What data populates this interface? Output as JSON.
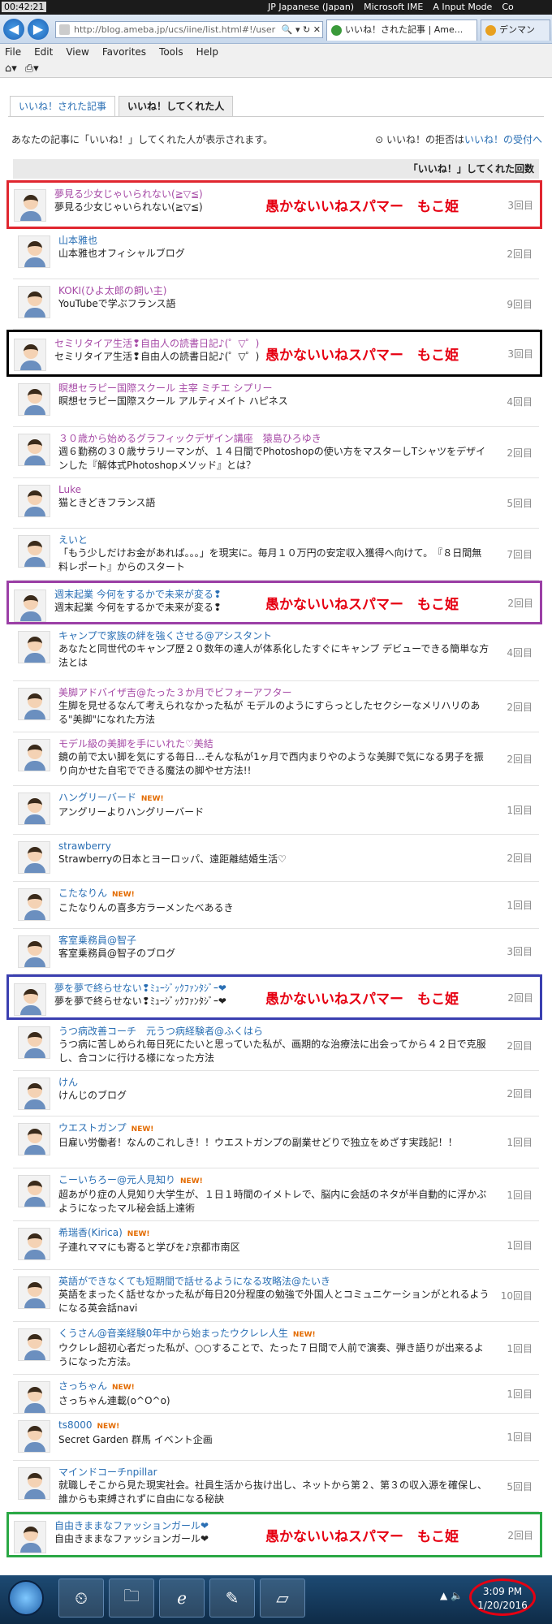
{
  "os": {
    "time_top": "00:42:21",
    "tray": [
      "JP Japanese (Japan)",
      "Microsoft IME",
      "A Input Mode",
      "Co"
    ],
    "clock_time": "3:09 PM",
    "clock_date": "1/20/2016"
  },
  "browser": {
    "url": "http://blog.ameba.jp/ucs/iine/list.html#!/user",
    "tab_active": "いいね！された記事 | Ame...",
    "tab_other": "デンマン"
  },
  "menu": [
    "File",
    "Edit",
    "View",
    "Favorites",
    "Tools",
    "Help"
  ],
  "tabs": [
    "いいね！された記事",
    "いいね！してくれた人"
  ],
  "intro": "あなたの記事に「いいね！」してくれた人が表示されます。",
  "reject": {
    "prefix": "いいね！の拒否は",
    "link": "いいね！の受付へ"
  },
  "header": "「いいね！」してくれた回数",
  "spam_label": "愚かないいねスパマー　もこ姫",
  "rows": [
    {
      "name": "夢見る少女じゃいられない(≧▽≦)",
      "blog": "夢見る少女じゃいられない(≧▽≦)",
      "count": "3回目",
      "visited": true,
      "new": false,
      "spam": true,
      "box": "#e0262f"
    },
    {
      "name": "山本雅也",
      "blog": "山本雅也オフィシャルブログ",
      "count": "2回目",
      "visited": false,
      "new": false,
      "spam": false,
      "box": ""
    },
    {
      "name": "KOKI(ひよ太郎の飼い主)",
      "blog": "YouTubeで学ぶフランス語",
      "count": "9回目",
      "visited": true,
      "new": false,
      "spam": false,
      "box": ""
    },
    {
      "name": "セミリタイア生活❢自由人の読書日記♪(゜▽゜)",
      "blog": "セミリタイア生活❢自由人の読書日記♪(゜▽゜)",
      "count": "3回目",
      "visited": true,
      "new": false,
      "spam": true,
      "box": "#000000"
    },
    {
      "name": "瞑想セラピー国際スクール 主宰 ミチエ シプリー",
      "blog": "瞑想セラピー国際スクール アルティメイト ハピネス",
      "count": "4回目",
      "visited": true,
      "new": false,
      "spam": false,
      "box": ""
    },
    {
      "name": "３０歳から始めるグラフィックデザイン講座　猿島ひろゆき",
      "blog": "週６勤務の３０歳サラリーマンが、１４日間でPhotoshopの使い方をマスターしTシャツをデザインした『解体式Photoshopメソッド』とは？",
      "count": "2回目",
      "visited": true,
      "new": false,
      "spam": false,
      "box": ""
    },
    {
      "name": "Luke",
      "blog": "猫ときどきフランス語",
      "count": "5回目",
      "visited": true,
      "new": false,
      "spam": false,
      "box": ""
    },
    {
      "name": "えいと",
      "blog": "「もう少しだけお金があれば。。。」を現実に。毎月１０万円の安定収入獲得へ向けて。　『８日間無料レポート』からのスタート",
      "count": "7回目",
      "visited": false,
      "new": false,
      "spam": false,
      "box": ""
    },
    {
      "name": "週末起業 今何をするかで未来が変る❢",
      "blog": "週末起業 今何をするかで未来が変る❢",
      "count": "2回目",
      "visited": false,
      "new": false,
      "spam": true,
      "box": "#9b3fa6"
    },
    {
      "name": "キャンプで家族の絆を強くさせる@アシスタント",
      "blog": "あなたと同世代のキャンプ歴２０数年の達人が体系化したすぐにキャンプ デビューできる簡単な方法とは",
      "count": "4回目",
      "visited": false,
      "new": false,
      "spam": false,
      "box": ""
    },
    {
      "name": "美脚アドバイザ吉@たった３か月でビフォーアフター",
      "blog": "生脚を見せるなんて考えられなかった私が モデルのようにすらっとしたセクシーなメリハリのある\"美脚\"になれた方法",
      "count": "2回目",
      "visited": true,
      "new": false,
      "spam": false,
      "box": ""
    },
    {
      "name": "モデル級の美脚を手にいれた♡美結",
      "blog": "鏡の前で太い脚を気にする毎日…そんな私が1ヶ月で西内まりやのような美脚で気になる男子を振り向かせた自宅でできる魔法の脚やせ方法!!",
      "count": "2回目",
      "visited": true,
      "new": false,
      "spam": false,
      "box": ""
    },
    {
      "name": "ハングリーバード",
      "blog": "アングリーよりハングリーバード",
      "count": "1回目",
      "visited": false,
      "new": true,
      "spam": false,
      "box": ""
    },
    {
      "name": "strawberry",
      "blog": "Strawberryの日本とヨーロッパ、遠距離結婚生活♡",
      "count": "2回目",
      "visited": false,
      "new": false,
      "spam": false,
      "box": ""
    },
    {
      "name": "こたなりん",
      "blog": "こたなりんの喜多方ラーメンたべあるき",
      "count": "1回目",
      "visited": false,
      "new": true,
      "spam": false,
      "box": ""
    },
    {
      "name": "客室乗務員@智子",
      "blog": "客室乗務員@智子のブログ",
      "count": "3回目",
      "visited": false,
      "new": false,
      "spam": false,
      "box": ""
    },
    {
      "name": "夢を夢で終らせない❢ﾐｭｰｼﾞｯｸﾌｧﾝﾀｼﾞｰ❤",
      "blog": "夢を夢で終らせない❢ﾐｭｰｼﾞｯｸﾌｧﾝﾀｼﾞｰ❤",
      "count": "2回目",
      "visited": false,
      "new": false,
      "spam": true,
      "box": "#3a3fb0"
    },
    {
      "name": "うつ病改善コーチ　元うつ病経験者@ふくはら",
      "blog": "うつ病に苦しめられ毎日死にたいと思っていた私が、画期的な治療法に出会ってから４２日で克服し、合コンに行ける様になった方法",
      "count": "2回目",
      "visited": false,
      "new": false,
      "spam": false,
      "box": ""
    },
    {
      "name": "けん",
      "blog": "けんじのブログ",
      "count": "2回目",
      "visited": false,
      "new": false,
      "spam": false,
      "box": ""
    },
    {
      "name": "ウエストガンプ",
      "blog": "日雇い労働者！なんのこれしき！！ウエストガンプの副業せどりで独立をめざす実践記！！",
      "count": "1回目",
      "visited": false,
      "new": true,
      "spam": false,
      "box": ""
    },
    {
      "name": "こーいちろー@元人見知り",
      "blog": "超あがり症の人見知り大学生が、１日１時間のイメトレで、脳内に会話のネタが半自動的に浮かぶようになったマル秘会話上達術",
      "count": "1回目",
      "visited": false,
      "new": true,
      "spam": false,
      "box": ""
    },
    {
      "name": "希瑞香(Kirica)",
      "blog": "子連れママにも寄ると学びを♪京都市南区",
      "count": "1回目",
      "visited": false,
      "new": true,
      "spam": false,
      "box": ""
    },
    {
      "name": "英語ができなくても短期間で話せるようになる攻略法@たいき",
      "blog": "英語をまったく話せなかった私が毎日20分程度の勉強で外国人とコミュニケーションがとれるようになる英会話navi",
      "count": "10回目",
      "visited": false,
      "new": false,
      "spam": false,
      "box": ""
    },
    {
      "name": "くうさん@音楽経験0年中から始まったウクレレ人生",
      "blog": "ウクレレ超初心者だった私が、○○することで、たった７日間で人前で演奏、弾き語りが出来るようになった方法。",
      "count": "1回目",
      "visited": false,
      "new": true,
      "spam": false,
      "box": ""
    },
    {
      "name": "さっちゃん",
      "blog": "さっちゃん連載(o^O^o)",
      "count": "1回目",
      "visited": false,
      "new": true,
      "spam": false,
      "box": ""
    },
    {
      "name": "ts8000",
      "blog": "Secret Garden 群馬 イベント企画",
      "count": "1回目",
      "visited": false,
      "new": true,
      "spam": false,
      "box": ""
    },
    {
      "name": "マインドコーチnpillar",
      "blog": "就職しそこから見た現実社会。社員生活から抜け出し、ネットから第２、第３の収入源を確保し、誰からも束縛されずに自由になる秘訣",
      "count": "5回目",
      "visited": false,
      "new": false,
      "spam": false,
      "box": ""
    },
    {
      "name": "自由きままなファッションガール❤",
      "blog": "自由きままなファッションガール❤",
      "count": "2回目",
      "visited": false,
      "new": false,
      "spam": true,
      "box": "#2aa845"
    }
  ]
}
